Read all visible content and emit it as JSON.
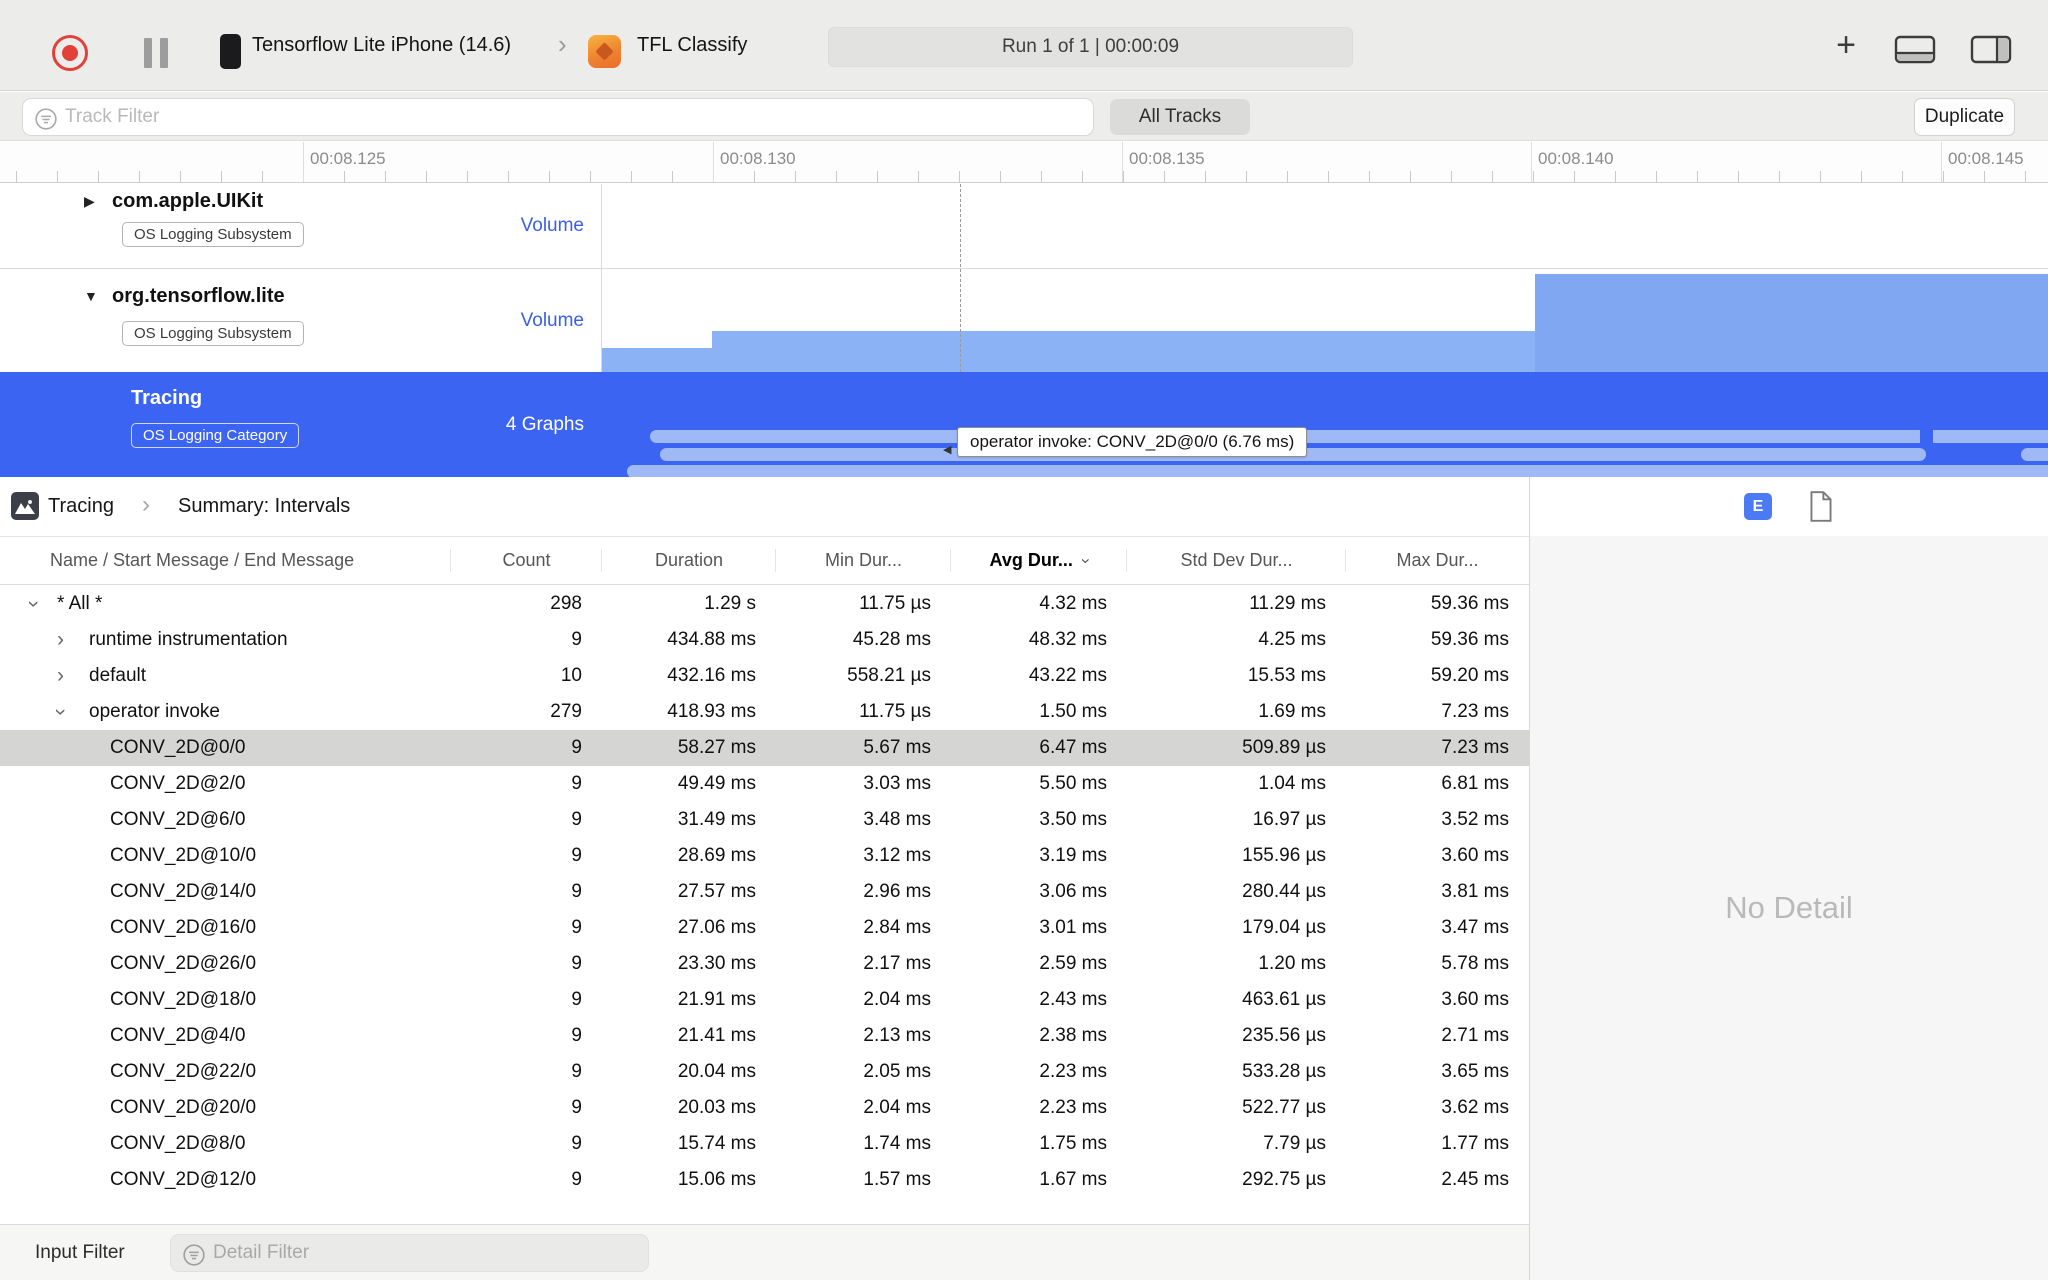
{
  "colors": {
    "accent_blue": "#3c64f3",
    "interval_bar_blue": "#9fb9f6",
    "volume_bar_blue": "#8ab2f5",
    "record_red": "#e14138",
    "selected_row_gray": "#d5d5d4"
  },
  "toolbar": {
    "device": "Tensorflow Lite iPhone (14.6)",
    "target": "TFL Classify",
    "run_status": "Run 1 of 1  |  00:00:09"
  },
  "filter_bar": {
    "track_filter_placeholder": "Track Filter",
    "all_tracks": "All Tracks",
    "duplicate": "Duplicate"
  },
  "ruler": {
    "labels": [
      "00:08.125",
      "00:08.130",
      "00:08.135",
      "00:08.140",
      "00:08.145"
    ]
  },
  "tracks": {
    "uikit": {
      "name": "com.apple.UIKit",
      "badge": "OS Logging Subsystem",
      "meta": "Volume"
    },
    "tensorflow": {
      "name": "org.tensorflow.lite",
      "badge": "OS Logging Subsystem",
      "meta": "Volume"
    },
    "tracing": {
      "name": "Tracing",
      "badge": "OS Logging Category",
      "meta": "4 Graphs"
    }
  },
  "tooltip": {
    "text": "operator invoke: CONV_2D@0/0 (6.76 ms)"
  },
  "detail": {
    "breadcrumb": {
      "root": "Tracing",
      "page": "Summary: Intervals"
    },
    "inspector_button": "E",
    "columns": [
      "Name / Start Message / End Message",
      "Count",
      "Duration",
      "Min Dur...",
      "Avg Dur...",
      "Std Dev Dur...",
      "Max Dur..."
    ],
    "rows": [
      {
        "name": "* All *",
        "count": "298",
        "duration": "1.29 s",
        "min": "11.75 µs",
        "avg": "4.32 ms",
        "std": "11.29 ms",
        "max": "59.36 ms",
        "level": 0,
        "disclosure": "expanded",
        "selected": false
      },
      {
        "name": "runtime instrumentation",
        "count": "9",
        "duration": "434.88 ms",
        "min": "45.28 ms",
        "avg": "48.32 ms",
        "std": "4.25 ms",
        "max": "59.36 ms",
        "level": 1,
        "disclosure": "collapsed",
        "selected": false
      },
      {
        "name": "default",
        "count": "10",
        "duration": "432.16 ms",
        "min": "558.21 µs",
        "avg": "43.22 ms",
        "std": "15.53 ms",
        "max": "59.20 ms",
        "level": 1,
        "disclosure": "collapsed",
        "selected": false
      },
      {
        "name": "operator invoke",
        "count": "279",
        "duration": "418.93 ms",
        "min": "11.75 µs",
        "avg": "1.50 ms",
        "std": "1.69 ms",
        "max": "7.23 ms",
        "level": 1,
        "disclosure": "expanded",
        "selected": false
      },
      {
        "name": "CONV_2D@0/0",
        "count": "9",
        "duration": "58.27 ms",
        "min": "5.67 ms",
        "avg": "6.47 ms",
        "std": "509.89 µs",
        "max": "7.23 ms",
        "level": 2,
        "disclosure": "none",
        "selected": true
      },
      {
        "name": "CONV_2D@2/0",
        "count": "9",
        "duration": "49.49 ms",
        "min": "3.03 ms",
        "avg": "5.50 ms",
        "std": "1.04 ms",
        "max": "6.81 ms",
        "level": 2,
        "disclosure": "none",
        "selected": false
      },
      {
        "name": "CONV_2D@6/0",
        "count": "9",
        "duration": "31.49 ms",
        "min": "3.48 ms",
        "avg": "3.50 ms",
        "std": "16.97 µs",
        "max": "3.52 ms",
        "level": 2,
        "disclosure": "none",
        "selected": false
      },
      {
        "name": "CONV_2D@10/0",
        "count": "9",
        "duration": "28.69 ms",
        "min": "3.12 ms",
        "avg": "3.19 ms",
        "std": "155.96 µs",
        "max": "3.60 ms",
        "level": 2,
        "disclosure": "none",
        "selected": false
      },
      {
        "name": "CONV_2D@14/0",
        "count": "9",
        "duration": "27.57 ms",
        "min": "2.96 ms",
        "avg": "3.06 ms",
        "std": "280.44 µs",
        "max": "3.81 ms",
        "level": 2,
        "disclosure": "none",
        "selected": false
      },
      {
        "name": "CONV_2D@16/0",
        "count": "9",
        "duration": "27.06 ms",
        "min": "2.84 ms",
        "avg": "3.01 ms",
        "std": "179.04 µs",
        "max": "3.47 ms",
        "level": 2,
        "disclosure": "none",
        "selected": false
      },
      {
        "name": "CONV_2D@26/0",
        "count": "9",
        "duration": "23.30 ms",
        "min": "2.17 ms",
        "avg": "2.59 ms",
        "std": "1.20 ms",
        "max": "5.78 ms",
        "level": 2,
        "disclosure": "none",
        "selected": false
      },
      {
        "name": "CONV_2D@18/0",
        "count": "9",
        "duration": "21.91 ms",
        "min": "2.04 ms",
        "avg": "2.43 ms",
        "std": "463.61 µs",
        "max": "3.60 ms",
        "level": 2,
        "disclosure": "none",
        "selected": false
      },
      {
        "name": "CONV_2D@4/0",
        "count": "9",
        "duration": "21.41 ms",
        "min": "2.13 ms",
        "avg": "2.38 ms",
        "std": "235.56 µs",
        "max": "2.71 ms",
        "level": 2,
        "disclosure": "none",
        "selected": false
      },
      {
        "name": "CONV_2D@22/0",
        "count": "9",
        "duration": "20.04 ms",
        "min": "2.05 ms",
        "avg": "2.23 ms",
        "std": "533.28 µs",
        "max": "3.65 ms",
        "level": 2,
        "disclosure": "none",
        "selected": false
      },
      {
        "name": "CONV_2D@20/0",
        "count": "9",
        "duration": "20.03 ms",
        "min": "2.04 ms",
        "avg": "2.23 ms",
        "std": "522.77 µs",
        "max": "3.62 ms",
        "level": 2,
        "disclosure": "none",
        "selected": false
      },
      {
        "name": "CONV_2D@8/0",
        "count": "9",
        "duration": "15.74 ms",
        "min": "1.74 ms",
        "avg": "1.75 ms",
        "std": "7.79 µs",
        "max": "1.77 ms",
        "level": 2,
        "disclosure": "none",
        "selected": false
      },
      {
        "name": "CONV_2D@12/0",
        "count": "9",
        "duration": "15.06 ms",
        "min": "1.57 ms",
        "avg": "1.67 ms",
        "std": "292.75 µs",
        "max": "2.45 ms",
        "level": 2,
        "disclosure": "none",
        "selected": false
      }
    ],
    "no_detail": "No Detail",
    "filters": {
      "input_label": "Input Filter",
      "placeholder": "Detail Filter"
    }
  }
}
